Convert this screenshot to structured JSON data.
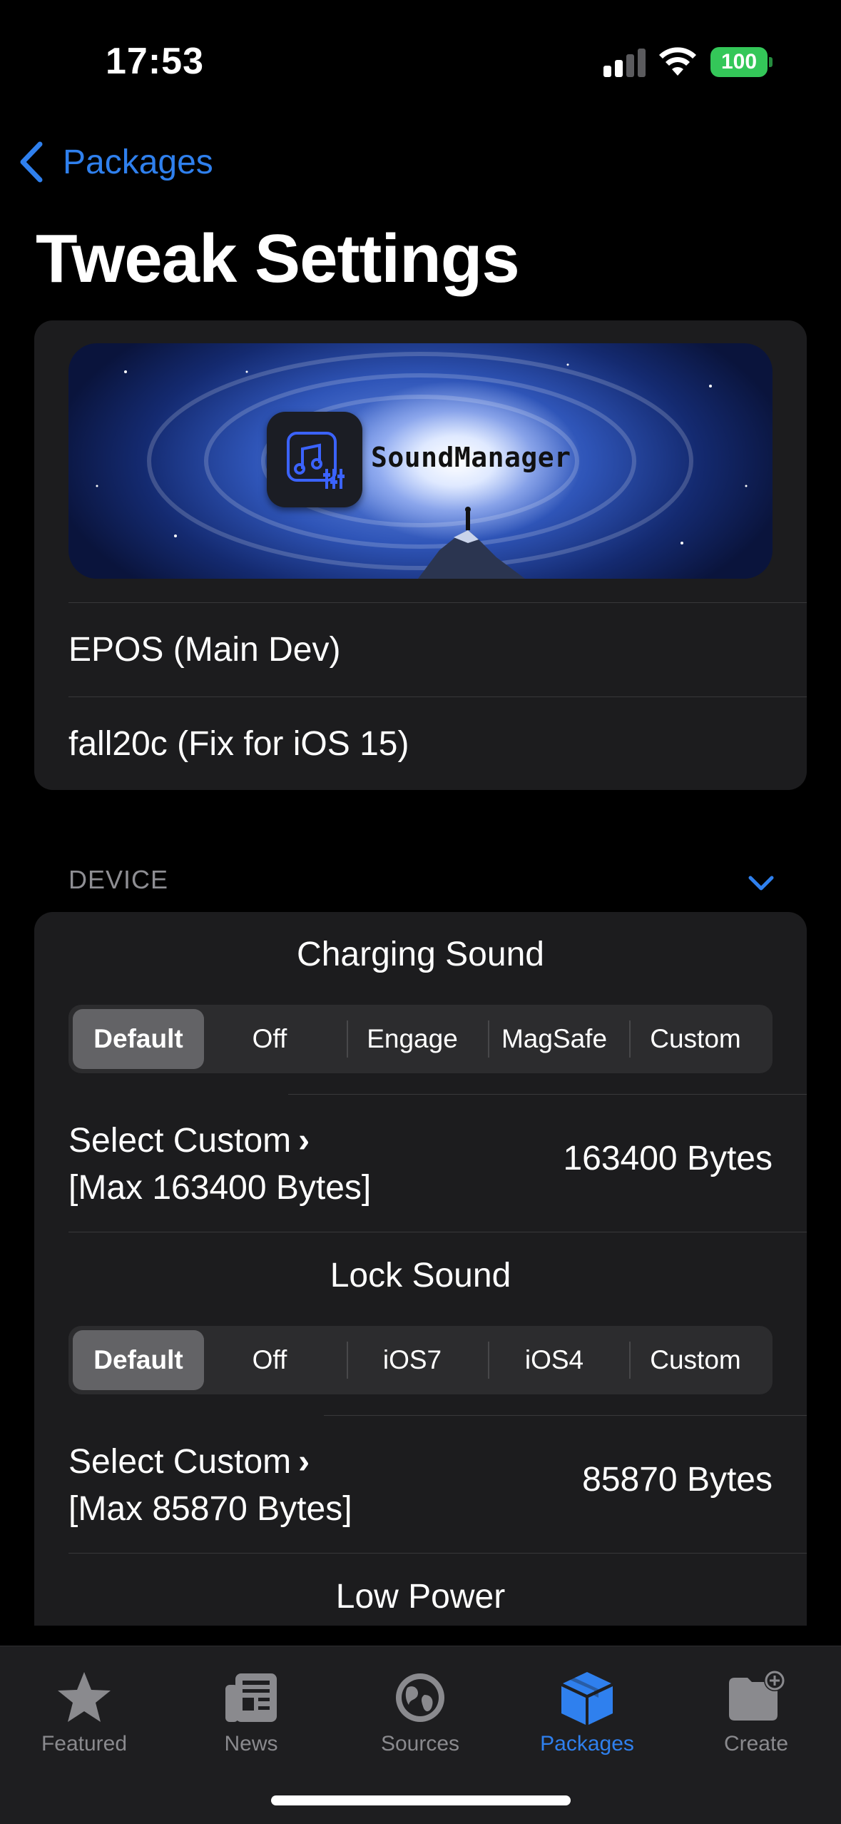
{
  "status_bar": {
    "time": "17:53",
    "battery": "100",
    "battery_color": "#34c759"
  },
  "nav": {
    "back_label": "Packages",
    "title": "Tweak Settings"
  },
  "header_card": {
    "banner_name": "SoundManager",
    "credits": [
      "EPOS (Main Dev)",
      "fall20c (Fix for iOS 15)"
    ]
  },
  "device_section": {
    "header": "DEVICE",
    "charging": {
      "title": "Charging Sound",
      "options": [
        "Default",
        "Off",
        "Engage",
        "MagSafe",
        "Custom"
      ],
      "selected": "Default",
      "custom_label": "Select Custom",
      "custom_sublabel": "[Max 163400 Bytes]",
      "custom_value": "163400 Bytes"
    },
    "lock": {
      "title": "Lock Sound",
      "options": [
        "Default",
        "Off",
        "iOS7",
        "iOS4",
        "Custom"
      ],
      "selected": "Default",
      "custom_label": "Select Custom",
      "custom_sublabel": "[Max 85870 Bytes]",
      "custom_value": "85870 Bytes"
    },
    "low_power": {
      "title": "Low Power"
    }
  },
  "tab_bar": {
    "accent": "#2f80ee",
    "tabs": [
      {
        "label": "Featured",
        "icon": "star-icon"
      },
      {
        "label": "News",
        "icon": "newspaper-icon"
      },
      {
        "label": "Sources",
        "icon": "globe-icon"
      },
      {
        "label": "Packages",
        "icon": "box-icon",
        "active": true
      },
      {
        "label": "Create",
        "icon": "folder-plus-icon"
      }
    ]
  }
}
